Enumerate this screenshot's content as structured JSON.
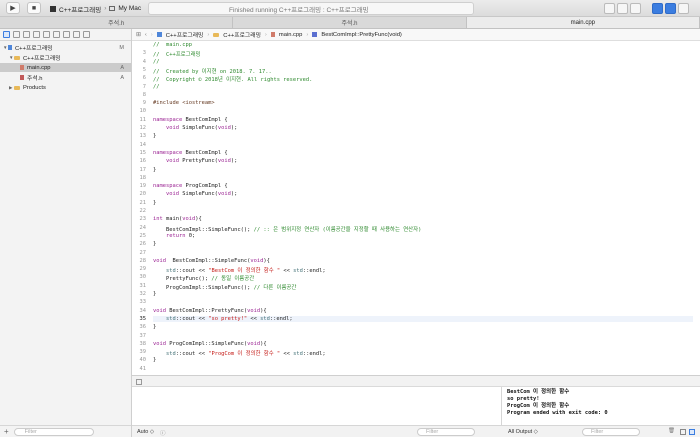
{
  "toolbar": {
    "run_glyph": "▶",
    "stop_glyph": "■",
    "scheme_name": "C++프로그래밍",
    "destination": "My Mac",
    "status_text": "Finished running C++프로그래밍 : C++프로그래밍"
  },
  "tabs": [
    {
      "label": "주석.h",
      "active": false
    },
    {
      "label": "주석.h",
      "active": false
    },
    {
      "label": "main.cpp",
      "active": true
    }
  ],
  "navigator": {
    "items": [
      {
        "label": "C++프로그래밍",
        "status": "M",
        "kind": "project",
        "selected": false
      },
      {
        "label": "C++프로그래밍",
        "status": "",
        "kind": "folder",
        "selected": false
      },
      {
        "label": "main.cpp",
        "status": "A",
        "kind": "cpp",
        "selected": true
      },
      {
        "label": "주석.h",
        "status": "A",
        "kind": "h",
        "selected": false
      },
      {
        "label": "Products",
        "status": "",
        "kind": "folder",
        "selected": false
      }
    ],
    "filter_placeholder": "Filter"
  },
  "jumpbar": {
    "project": "C++프로그래밍",
    "folder": "C++프로그래밍",
    "file": "main.cpp",
    "symbol": "BestComImpl::PrettyFunc(void)"
  },
  "editor": {
    "current_line": "35",
    "lines": [
      {
        "n": "",
        "t": "//  main.cpp",
        "c": "comment"
      },
      {
        "n": "3",
        "t": "//  C++프로그래밍",
        "c": "comment"
      },
      {
        "n": "4",
        "t": "//",
        "c": "comment"
      },
      {
        "n": "5",
        "t": "//  Created by 이지현 on 2018. 7. 17..",
        "c": "comment"
      },
      {
        "n": "6",
        "t": "//  Copyright © 2018년 이지현. All rights reserved.",
        "c": "comment"
      },
      {
        "n": "7",
        "t": "//",
        "c": "comment"
      },
      {
        "n": "8",
        "t": "",
        "c": ""
      },
      {
        "n": "9",
        "t": "#include <iostream>",
        "c": "pre"
      },
      {
        "n": "10",
        "t": "",
        "c": ""
      },
      {
        "n": "11",
        "t": "namespace BestComImpl {",
        "c": "ns"
      },
      {
        "n": "12",
        "t": "    void SimpleFunc(void);",
        "c": "decl"
      },
      {
        "n": "13",
        "t": "}",
        "c": ""
      },
      {
        "n": "14",
        "t": "",
        "c": ""
      },
      {
        "n": "15",
        "t": "namespace BestComImpl {",
        "c": "ns"
      },
      {
        "n": "16",
        "t": "    void PrettyFunc(void);",
        "c": "decl"
      },
      {
        "n": "17",
        "t": "}",
        "c": ""
      },
      {
        "n": "18",
        "t": "",
        "c": ""
      },
      {
        "n": "19",
        "t": "namespace ProgComImpl {",
        "c": "ns"
      },
      {
        "n": "20",
        "t": "    void SimpleFunc(void);",
        "c": "decl"
      },
      {
        "n": "21",
        "t": "}",
        "c": ""
      },
      {
        "n": "22",
        "t": "",
        "c": ""
      },
      {
        "n": "23",
        "t": "int main(void){",
        "c": "decl"
      },
      {
        "n": "24",
        "t": "    BestComImpl::SimpleFunc(); // :: 은 범위지정 연산자 (이름공간을 지정할 때 사용하는 연산자)",
        "c": "call"
      },
      {
        "n": "25",
        "t": "    return 0;",
        "c": "ret"
      },
      {
        "n": "26",
        "t": "}",
        "c": ""
      },
      {
        "n": "27",
        "t": "",
        "c": ""
      },
      {
        "n": "28",
        "t": "void  BestComImpl::SimpleFunc(void){",
        "c": "def"
      },
      {
        "n": "29",
        "t": "    std::cout << \"BestCom 이 정의한 함수 \" << std::endl;",
        "c": "cout"
      },
      {
        "n": "30",
        "t": "    PrettyFunc(); // 동일 이름공간",
        "c": "call"
      },
      {
        "n": "31",
        "t": "    ProgComImpl::SimpleFunc(); // 다른 이름공간",
        "c": "call"
      },
      {
        "n": "32",
        "t": "}",
        "c": ""
      },
      {
        "n": "33",
        "t": "",
        "c": ""
      },
      {
        "n": "34",
        "t": "void BestComImpl::PrettyFunc(void){",
        "c": "def"
      },
      {
        "n": "35",
        "t": "    std::cout << \"so pretty!\" << std::endl;",
        "c": "cout"
      },
      {
        "n": "36",
        "t": "}",
        "c": ""
      },
      {
        "n": "37",
        "t": "",
        "c": ""
      },
      {
        "n": "38",
        "t": "void ProgComImpl::SimpleFunc(void){",
        "c": "def"
      },
      {
        "n": "39",
        "t": "    std::cout << \"ProgCom 이 정의한 함수 \" << std::endl;",
        "c": "cout"
      },
      {
        "n": "40",
        "t": "}",
        "c": ""
      },
      {
        "n": "41",
        "t": "",
        "c": ""
      }
    ]
  },
  "console": {
    "lines": [
      "BestCom 이 정의한 함수",
      "so pretty!",
      "ProgCom 이 정의한 함수",
      "Program ended with exit code: 0"
    ]
  },
  "bottom_bar": {
    "auto_label": "Auto ◇",
    "vars_filter_placeholder": "Filter",
    "output_label": "All Output ◇",
    "console_filter_placeholder": "Filter"
  },
  "colors": {
    "comment": "#2f8a2f",
    "keyword": "#9b2393",
    "string": "#c41a16",
    "type": "#3f6e74",
    "preprocessor": "#643820",
    "accent": "#3b7de0"
  }
}
